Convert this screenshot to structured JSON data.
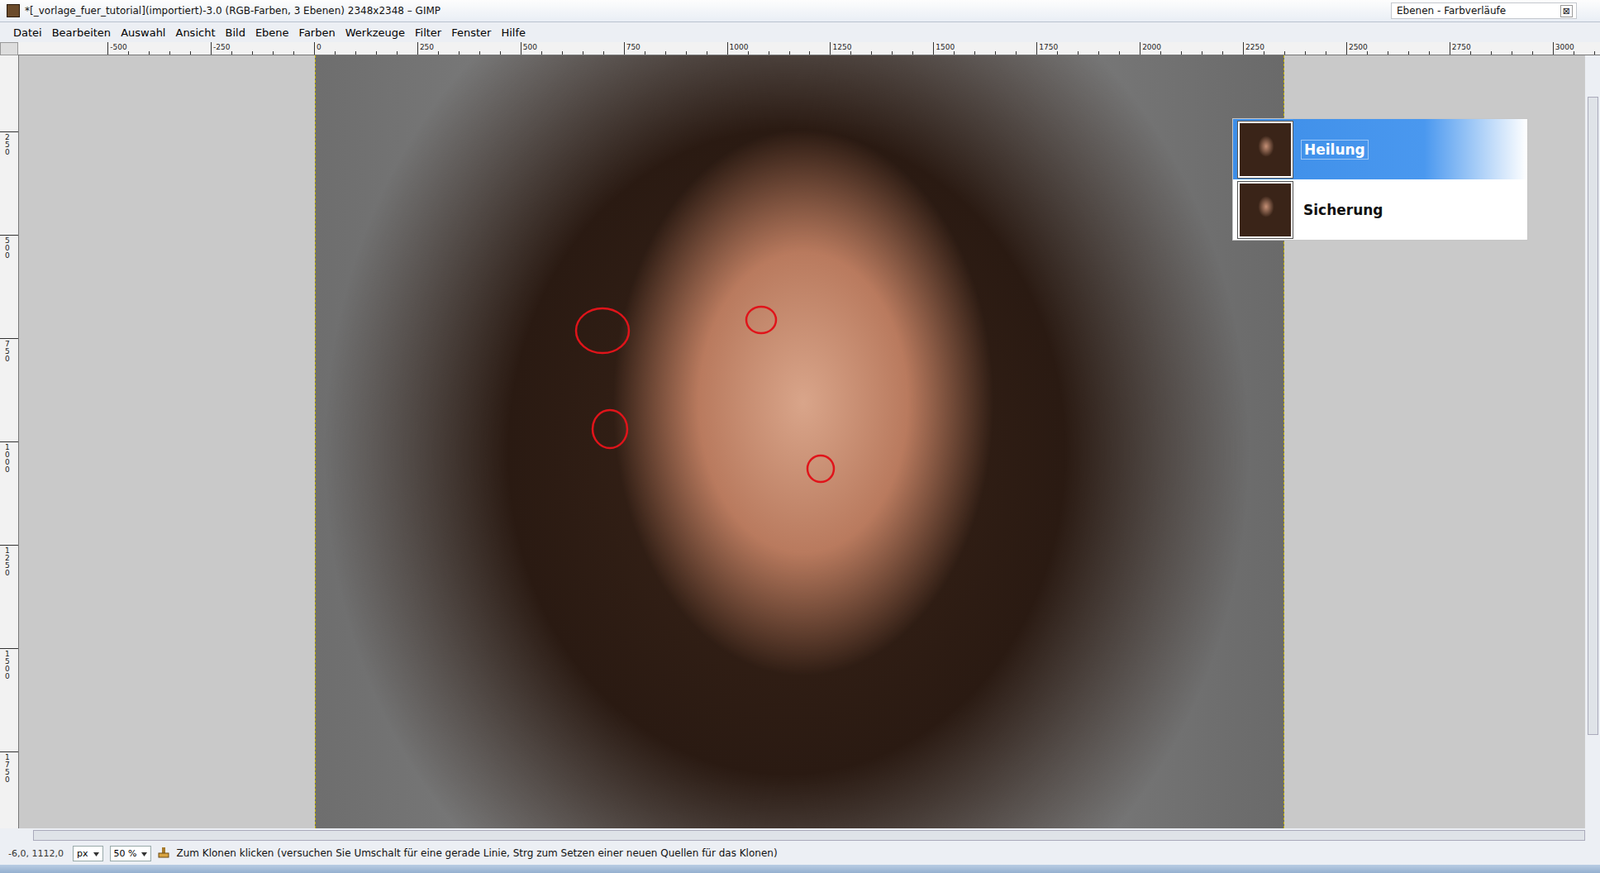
{
  "window": {
    "title": "*[_vorlage_fuer_tutorial](importiert)-3.0 (RGB-Farben, 3 Ebenen) 2348x2348 – GIMP"
  },
  "dock": {
    "title": "Ebenen - Farbverläufe",
    "close": "⊠"
  },
  "menu": [
    "Datei",
    "Bearbeiten",
    "Auswahl",
    "Ansicht",
    "Bild",
    "Ebene",
    "Farben",
    "Werkzeuge",
    "Filter",
    "Fenster",
    "Hilfe"
  ],
  "ruler_top": [
    "-500",
    "-250",
    "0",
    "250",
    "500",
    "750",
    "1000",
    "1250",
    "1500",
    "1750",
    "2000",
    "2250",
    "2500",
    "2750",
    "3000"
  ],
  "ruler_left": [
    "250",
    "500",
    "750",
    "1000",
    "1250",
    "1500",
    "1750"
  ],
  "layers": [
    {
      "name": "Heilung",
      "selected": true
    },
    {
      "name": "Sicherung",
      "selected": false
    }
  ],
  "status_bar": {
    "coords": "-6,0, 1112,0",
    "unit": "px",
    "zoom": "50 %",
    "message": "Zum Klonen klicken (versuchen Sie Umschalt für eine gerade Linie, Strg zum Setzen einer neuen Quellen für das Klonen)"
  }
}
